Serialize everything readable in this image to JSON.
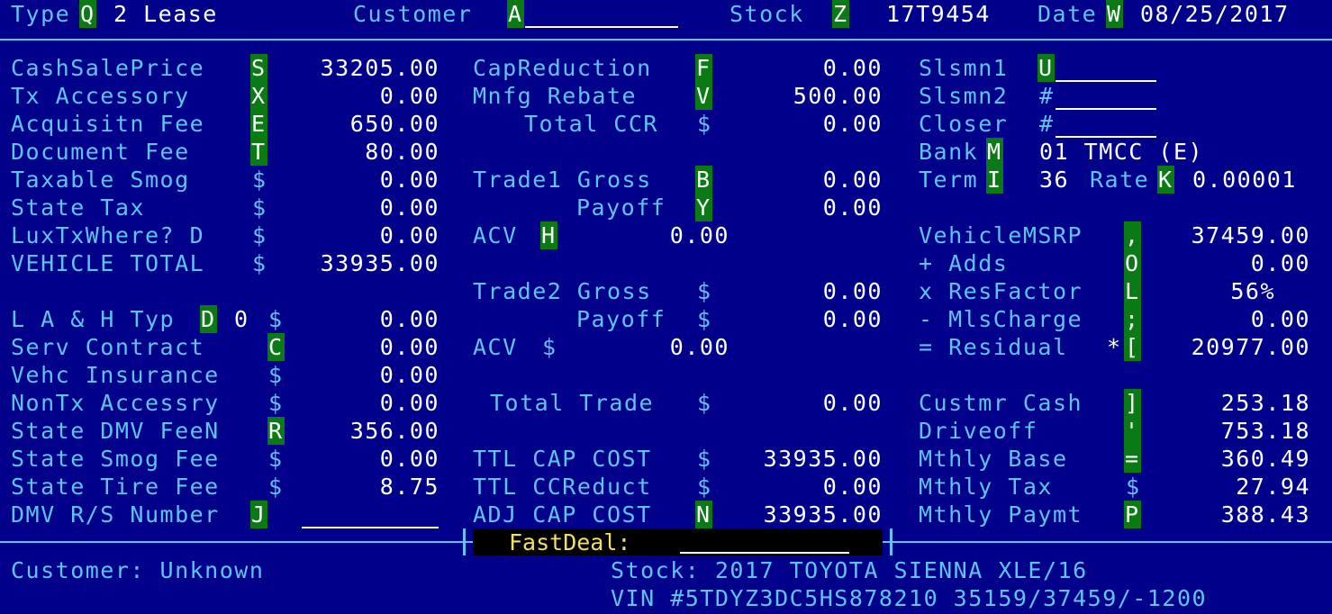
{
  "header": {
    "type_label": "Type",
    "type_key": "Q",
    "type_value": "2 Lease",
    "customer_label": "Customer",
    "customer_key": "A",
    "stock_label": "Stock",
    "stock_key": "Z",
    "stock_value": "17T9454",
    "date_label": "Date",
    "date_key": "W",
    "date_value": "08/25/2017"
  },
  "left": [
    {
      "label": "CashSalePrice",
      "key": "S",
      "value": "33205.00"
    },
    {
      "label": "Tx Accessory",
      "key": "X",
      "value": "0.00"
    },
    {
      "label": "Acquisitn Fee",
      "key": "E",
      "value": "650.00"
    },
    {
      "label": "Document Fee",
      "key": "T",
      "value": "80.00"
    },
    {
      "label": "Taxable Smog",
      "key": "$",
      "value": "0.00"
    },
    {
      "label": "State Tax",
      "key": "$",
      "value": "0.00"
    },
    {
      "label": "LuxTxWhere? D",
      "key": "$",
      "value": "0.00"
    },
    {
      "label": "VEHICLE TOTAL",
      "key": "$",
      "value": "33935.00"
    },
    {
      "label": "L A & H Typ",
      "key": "D",
      "extra": "0",
      "key2": "$",
      "value": "0.00"
    },
    {
      "label": "Serv Contract",
      "key": "C",
      "value": "0.00"
    },
    {
      "label": "Vehc Insurance",
      "key": "$",
      "value": "0.00"
    },
    {
      "label": "NonTx Accessry",
      "key": "$",
      "value": "0.00"
    },
    {
      "label": "State DMV FeeN",
      "key": "R",
      "value": "356.00"
    },
    {
      "label": "State Smog Fee",
      "key": "$",
      "value": "0.00"
    },
    {
      "label": "State Tire Fee",
      "key": "$",
      "value": "8.75"
    },
    {
      "label": "DMV R/S Number",
      "key": "J",
      "value": ""
    }
  ],
  "middle": [
    {
      "label": "CapReduction",
      "key": "F",
      "value": "0.00"
    },
    {
      "label": "Mnfg Rebate",
      "key": "V",
      "value": "500.00"
    },
    {
      "label": "Total CCR",
      "key": "$",
      "value": "0.00"
    },
    {
      "label": "Trade1 Gross",
      "key": "B",
      "value": "0.00"
    },
    {
      "label": "Payoff",
      "key": "Y",
      "value": "0.00"
    },
    {
      "label": "ACV",
      "key": "H",
      "value": "0.00"
    },
    {
      "label": "Trade2 Gross",
      "key": "$",
      "value": "0.00"
    },
    {
      "label": "Payoff",
      "key": "$",
      "value": "0.00"
    },
    {
      "label": "ACV",
      "key": "$",
      "value": "0.00"
    },
    {
      "label": "Total Trade",
      "key": "$",
      "value": "0.00"
    },
    {
      "label": "TTL CAP COST",
      "key": "$",
      "value": "33935.00"
    },
    {
      "label": "TTL CCReduct",
      "key": "$",
      "value": "0.00"
    },
    {
      "label": "ADJ CAP COST",
      "key": "N",
      "value": "33935.00"
    }
  ],
  "right_top": {
    "slsmn1_label": "Slsmn1",
    "slsmn1_key": "U",
    "slsmn2_label": "Slsmn2",
    "slsmn2_key": "#",
    "closer_label": "Closer",
    "closer_key": "#",
    "bank_label": "Bank",
    "bank_key": "M",
    "bank_value": "01 TMCC (E)",
    "term_label": "Term",
    "term_key": "I",
    "term_value": "36",
    "rate_label": "Rate",
    "rate_key": "K",
    "rate_value": "0.00001"
  },
  "right": [
    {
      "label": "VehicleMSRP",
      "key": ",",
      "value": "37459.00"
    },
    {
      "label": "+ Adds",
      "key": "O",
      "value": "0.00"
    },
    {
      "label": "x ResFactor",
      "key": "L",
      "value": "56%"
    },
    {
      "label": "- MlsCharge",
      "key": ";",
      "value": "0.00"
    },
    {
      "label": "= Residual",
      "key": "[",
      "prefix": "*",
      "value": "20977.00"
    },
    {
      "label": "Custmr Cash",
      "key": "]",
      "value": "253.18"
    },
    {
      "label": "Driveoff",
      "key": "'",
      "value": "753.18"
    },
    {
      "label": "Mthly Base",
      "key": "=",
      "value": "360.49"
    },
    {
      "label": "Mthly Tax",
      "key": "$",
      "value": "27.94"
    },
    {
      "label": "Mthly Paymt",
      "key": "P",
      "value": "388.43"
    }
  ],
  "fastdeal_label": "FastDeal:",
  "footer": {
    "customer": "Customer: Unknown",
    "stock": "Stock: 2017 TOYOTA SIENNA XLE/16",
    "vin": "VIN #5TDYZ3DC5HS878210 35159/37459/-1200"
  }
}
